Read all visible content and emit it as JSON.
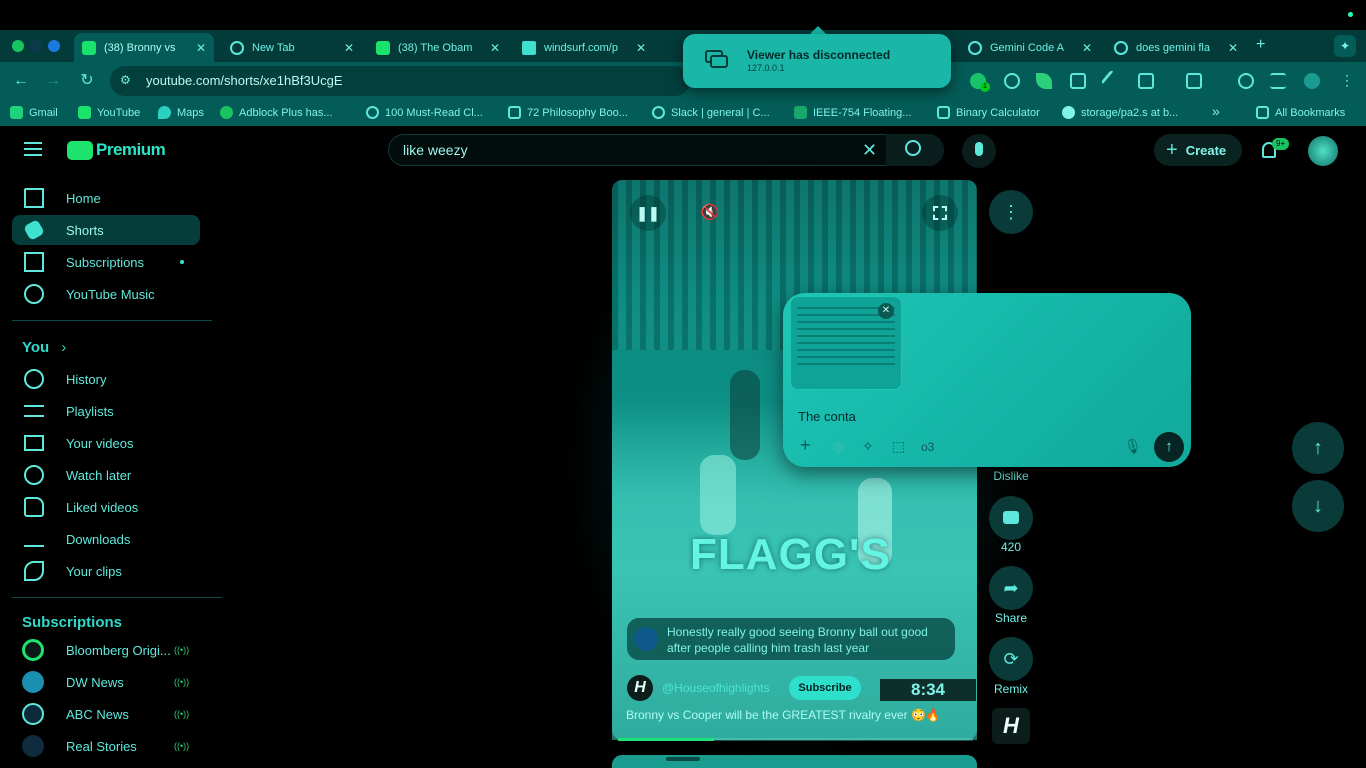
{
  "browser": {
    "tabs": [
      {
        "title": "(38) Bronny vs",
        "active": true
      },
      {
        "title": "New Tab",
        "active": false
      },
      {
        "title": "(38) The Obam",
        "active": false
      },
      {
        "title": "windsurf.com/p",
        "active": false
      },
      {
        "title": "Gemini Code A",
        "active": false
      },
      {
        "title": "does gemini fla",
        "active": false
      }
    ],
    "url": "youtube.com/shorts/xe1hBf3UcgE",
    "bookmarks": [
      "Gmail",
      "YouTube",
      "Maps",
      "Adblock Plus has...",
      "100 Must-Read Cl...",
      "72 Philosophy Boo...",
      "Slack | general | C...",
      "IEEE-754 Floating...",
      "Binary Calculator",
      "storage/pa2.s at b..."
    ],
    "all_bookmarks": "All Bookmarks",
    "overflow": "»",
    "ext_badge": "1"
  },
  "toast": {
    "title": "Viewer has disconnected",
    "subtitle": "127.0.0.1"
  },
  "youtube": {
    "logo": "Premium",
    "search_value": "like weezy",
    "create_label": "Create",
    "notif_badge": "9+",
    "sidebar": {
      "main": [
        "Home",
        "Shorts",
        "Subscriptions",
        "YouTube Music"
      ],
      "you_title": "You",
      "you_items": [
        "History",
        "Playlists",
        "Your videos",
        "Watch later",
        "Liked videos",
        "Downloads",
        "Your clips"
      ],
      "subs_title": "Subscriptions",
      "subs": [
        "Bloomberg Origi...",
        "DW News",
        "ABC News",
        "Real Stories"
      ],
      "live_marker": "((•))"
    },
    "short": {
      "overlay_text": "FLAGG'S",
      "comment": "Honestly really good seeing Bronny ball out good after people calling him trash last year",
      "channel": "@Houseofhighlights",
      "subscribe": "Subscribe",
      "score": "8:34",
      "title": "Bronny vs Cooper will be the GREATEST rivalry ever 😳🔥"
    },
    "rail": {
      "dislike": "Dislike",
      "comments": "420",
      "share": "Share",
      "remix": "Remix"
    }
  },
  "ai_popup": {
    "input_text": "The conta",
    "model": "o3"
  },
  "colors": {
    "accent": "#2ee0cc",
    "bg": "#000000",
    "chrome": "#045c58"
  }
}
